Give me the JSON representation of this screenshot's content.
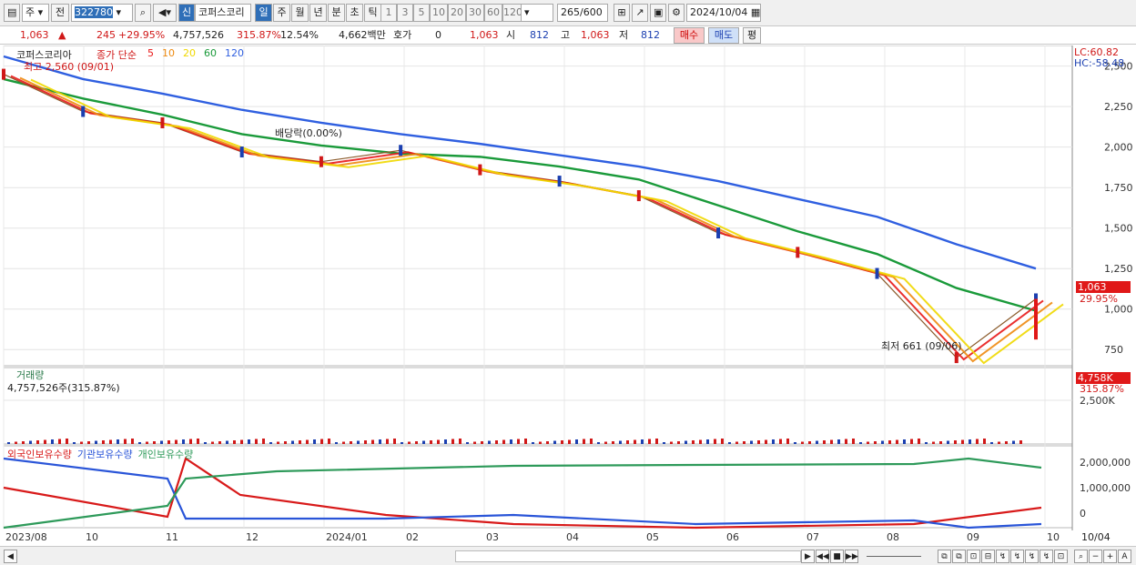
{
  "toolbar": {
    "market_type": "주",
    "all_label": "전",
    "code": "322780",
    "new_label": "신",
    "stock_name": "코퍼스코리",
    "periods": [
      "일",
      "주",
      "월",
      "년",
      "분",
      "초",
      "틱"
    ],
    "active_period": "일",
    "intervals": [
      "1",
      "3",
      "5",
      "10",
      "20",
      "30",
      "60",
      "120"
    ],
    "count": "265",
    "count_max": "/600",
    "date": "2024/10/04"
  },
  "quote": {
    "price": "1,063",
    "arrow": "▲",
    "change": "245",
    "change_pct": "+29.95%",
    "volume": "4,757,526",
    "volume_ratio": "315.87%",
    "turnover": "12.54%",
    "amount": "4,662백만",
    "hoga_label": "호가",
    "hoga_value": "0",
    "hoga_price": "1,063",
    "open_label": "시",
    "open": "812",
    "high_label": "고",
    "high": "1,063",
    "low_label": "저",
    "low": "812",
    "buy_label": "매수",
    "sell_label": "매도",
    "eval_label": "평"
  },
  "price_panel": {
    "name": "코퍼스코리아",
    "ma_label": "종가 단순",
    "ma_periods": [
      "5",
      "10",
      "20",
      "60",
      "120"
    ],
    "ma_colors": [
      "#e81818",
      "#ee8a10",
      "#f0d800",
      "#1a9a3a",
      "#2f5fe0"
    ],
    "max_label": "최고 2,560 (09/01)",
    "min_label": "최저 661 (09/06)",
    "dividend_label": "배당락(0.00%)",
    "lc_label": "LC:60.82",
    "hc_label": "HC:-58.48",
    "y_ticks": [
      "2,500",
      "2,250",
      "2,000",
      "1,750",
      "1,500",
      "1,250",
      "1,000",
      "750"
    ],
    "current_tag": "1,063",
    "current_pct": "29.95%"
  },
  "volume_panel": {
    "title": "거래량",
    "value_label": "4,757,526주(315.87%)",
    "y_ticks": [
      "2,500K"
    ],
    "current_tag": "4,758K",
    "current_pct": "315.87%"
  },
  "holding_panel": {
    "series": [
      {
        "name": "외국인보유수량",
        "color": "#d81a1a"
      },
      {
        "name": "기관보유수량",
        "color": "#2a55d8"
      },
      {
        "name": "개인보유수량",
        "color": "#2e9a5a"
      }
    ],
    "y_ticks": [
      "2,000,000",
      "1,000,000",
      "0"
    ]
  },
  "x_axis": {
    "labels": [
      "2023/08",
      "10",
      "11",
      "12",
      "2024/01",
      "02",
      "03",
      "04",
      "05",
      "06",
      "07",
      "08",
      "09",
      "10"
    ],
    "right_label": "10/04"
  },
  "chart_data": {
    "type": "line",
    "x": [
      "2023/08",
      "10",
      "11",
      "12",
      "2024/01",
      "02",
      "03",
      "04",
      "05",
      "06",
      "07",
      "08",
      "09",
      "10"
    ],
    "series": [
      {
        "name": "120",
        "values": [
          2560,
          2420,
          2330,
          2230,
          2150,
          2080,
          2020,
          1950,
          1880,
          1790,
          1680,
          1570,
          1400,
          1250
        ]
      },
      {
        "name": "60",
        "values": [
          2420,
          2300,
          2200,
          2080,
          2010,
          1960,
          1940,
          1880,
          1800,
          1640,
          1480,
          1340,
          1130,
          990
        ]
      },
      {
        "name": "종가",
        "values": [
          2450,
          2220,
          2150,
          1970,
          1910,
          1980,
          1860,
          1790,
          1700,
          1470,
          1350,
          1220,
          700,
          1063
        ]
      }
    ],
    "ylim": [
      650,
      2560
    ]
  }
}
